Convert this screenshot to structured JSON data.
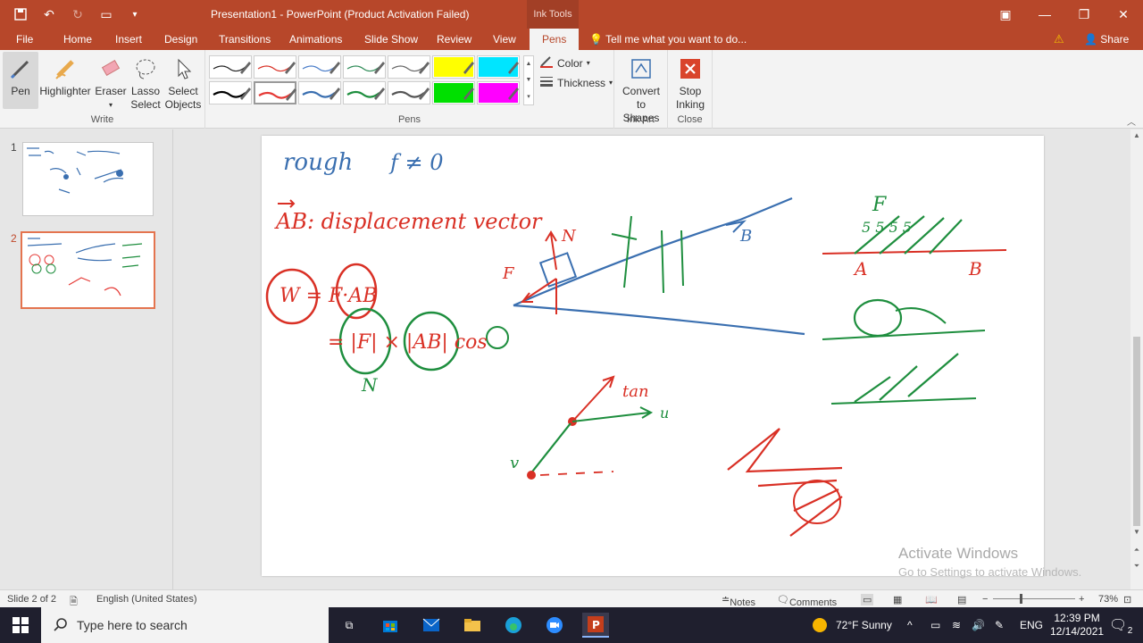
{
  "window": {
    "title": "Presentation1 - PowerPoint (Product Activation Failed)",
    "contextual_tab": "Ink Tools"
  },
  "tabs": [
    "File",
    "Home",
    "Insert",
    "Design",
    "Transitions",
    "Animations",
    "Slide Show",
    "Review",
    "View",
    "Pens"
  ],
  "active_tab": "Pens",
  "tell_me": "Tell me what you want to do...",
  "share": "Share",
  "ribbon": {
    "write": {
      "label": "Write",
      "pen": "Pen",
      "highlighter": "Highlighter",
      "eraser": "Eraser",
      "lasso_1": "Lasso",
      "lasso_2": "Select",
      "select_1": "Select",
      "select_2": "Objects"
    },
    "pens": {
      "label": "Pens",
      "color": "Color",
      "thickness": "Thickness",
      "swatches_row1": [
        "#222222",
        "#d93025",
        "#4a7dc9",
        "#2e8b57",
        "#666666",
        "#ffff00",
        "#00e5ff"
      ],
      "swatches_row2": [
        "#000000",
        "#e53935",
        "#3a6fb0",
        "#1e8e3e",
        "#555555",
        "#00e000",
        "#ff00ff"
      ]
    },
    "ink_art": {
      "label": "Ink Art",
      "convert_1": "Convert",
      "convert_2": "to Shapes"
    },
    "close": {
      "label": "Close",
      "stop_1": "Stop",
      "stop_2": "Inking"
    }
  },
  "thumbnails": [
    {
      "num": "1"
    },
    {
      "num": "2"
    }
  ],
  "slide": {
    "ink_text": {
      "rough": "rough",
      "f_neq": "f ≠ 0",
      "ab_def": "AB: displacement vector",
      "w_eq": "W = F·AB",
      "f_abs": "= |F| × |AB| cos",
      "n": "N",
      "f_lbl": "F",
      "b_lbl": "B",
      "a_lbl": "A",
      "b2_lbl": "B",
      "big_f": "F",
      "fives": "5  5 5 5",
      "tan": "tan",
      "u": "u",
      "v": "v"
    }
  },
  "watermark": {
    "line1": "Activate Windows",
    "line2": "Go to Settings to activate Windows."
  },
  "status": {
    "slide": "Slide 2 of 2",
    "language": "English (United States)",
    "notes": "Notes",
    "comments": "Comments",
    "zoom": "73%"
  },
  "taskbar": {
    "search_placeholder": "Type here to search",
    "weather": "72°F  Sunny",
    "lang": "ENG",
    "time": "12:39 PM",
    "date": "12/14/2021",
    "notif_count": "2"
  }
}
